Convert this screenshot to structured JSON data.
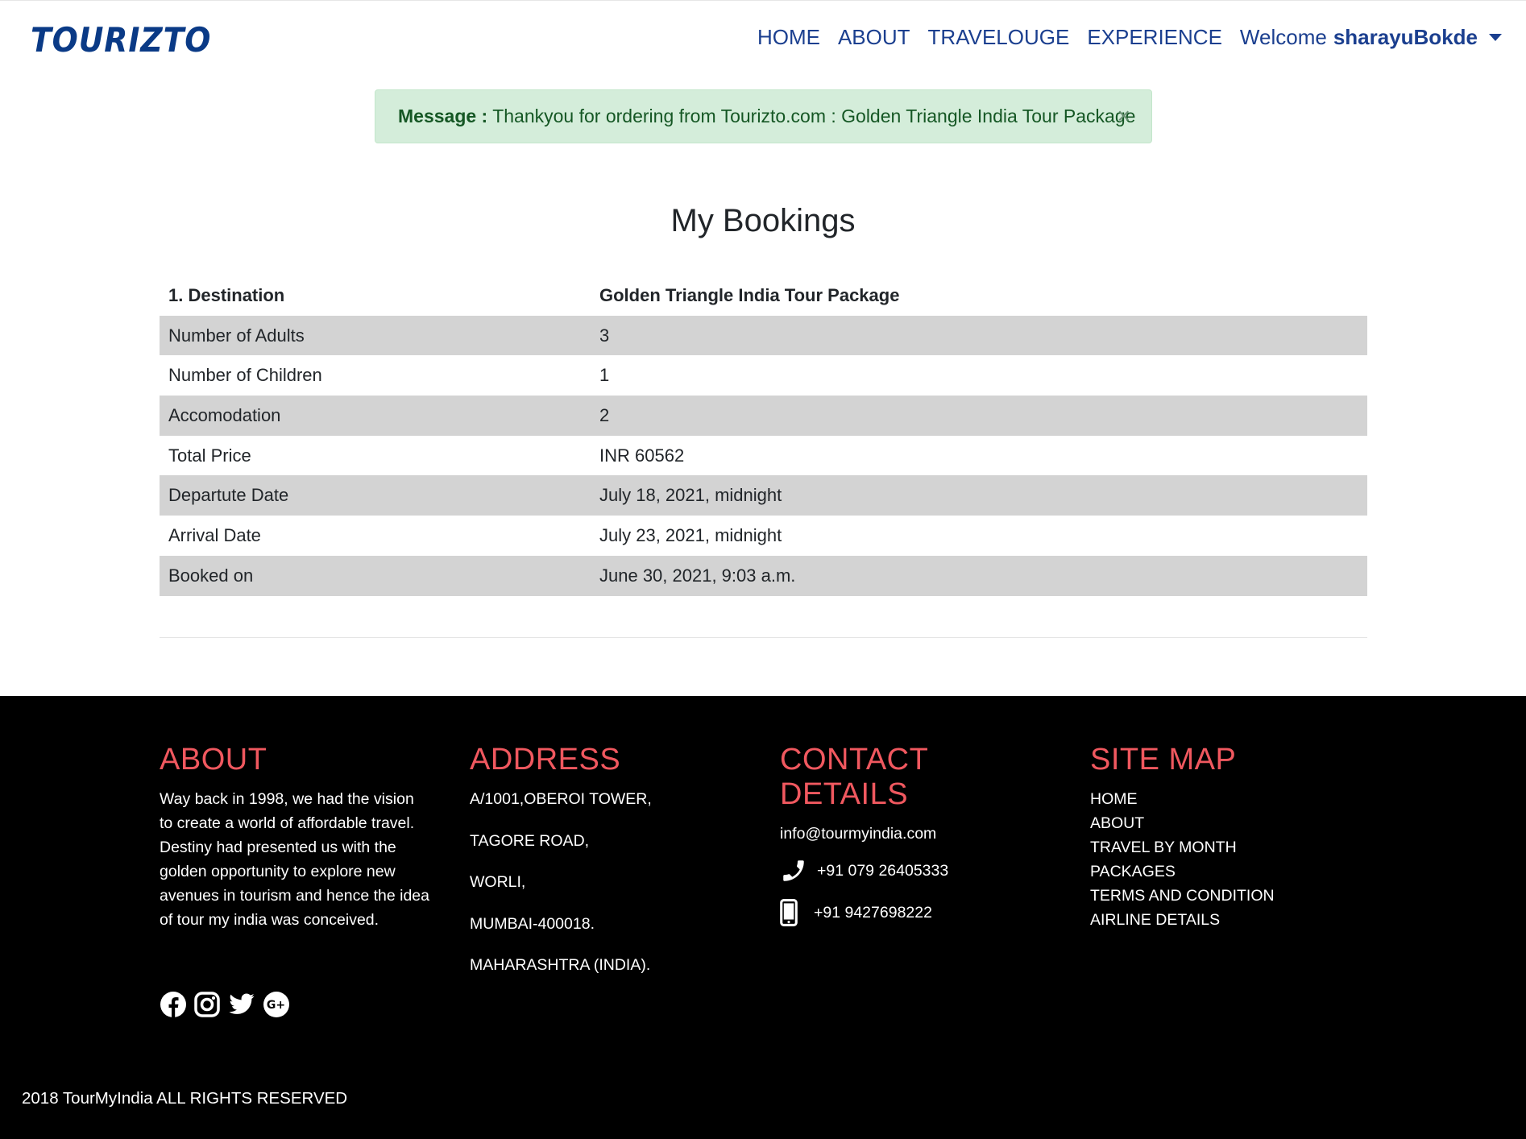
{
  "navbar": {
    "brand": "TOURIZTO",
    "links": [
      {
        "label": "HOME"
      },
      {
        "label": "ABOUT"
      },
      {
        "label": "TRAVELOUGE"
      },
      {
        "label": "EXPERIENCE"
      }
    ],
    "welcome_label": "Welcome",
    "username": "sharayuBokde"
  },
  "alert": {
    "prefix": "Message :",
    "text": "Thankyou for ordering from Tourizto.com : Golden Triangle India Tour Package",
    "close": "×"
  },
  "page_title": "My Bookings",
  "booking": {
    "rows": [
      {
        "label": "1. Destination",
        "value": "Golden Triangle India Tour Package"
      },
      {
        "label": "Number of Adults",
        "value": "3"
      },
      {
        "label": "Number of Children",
        "value": "1"
      },
      {
        "label": "Accomodation",
        "value": "2"
      },
      {
        "label": "Total Price",
        "value": "INR 60562"
      },
      {
        "label": "Departute Date",
        "value": "July 18, 2021, midnight"
      },
      {
        "label": "Arrival Date",
        "value": "July 23, 2021, midnight"
      },
      {
        "label": "Booked on",
        "value": "June 30, 2021, 9:03 a.m."
      }
    ]
  },
  "footer": {
    "about": {
      "title": "ABOUT",
      "lines": [
        "Way back in 1998, we had the vision",
        "to create a world of affordable travel.",
        "Destiny had presented us with the",
        "golden opportunity to explore new",
        "avenues in tourism and hence the idea",
        "of tour my india was conceived."
      ]
    },
    "address": {
      "title": "ADDRESS",
      "lines": [
        "A/1001,OBEROI TOWER,",
        "TAGORE ROAD,",
        "WORLI,",
        "MUMBAI-400018.",
        "MAHARASHTRA (INDIA)."
      ]
    },
    "contact": {
      "title": "CONTACT DETAILS",
      "email": "info@tourmyindia.com",
      "phone": "+91 079 26405333",
      "mobile": "+91 9427698222"
    },
    "sitemap": {
      "title": "SITE MAP",
      "links": [
        "HOME",
        "ABOUT",
        "TRAVEL BY MONTH",
        "PACKAGES",
        "TERMS AND CONDITION",
        "AIRLINE DETAILS"
      ]
    },
    "social_icons": [
      "facebook-icon",
      "instagram-icon",
      "twitter-icon",
      "google-plus-icon"
    ],
    "copyright": "2018 TourMyIndia ALL RIGHTS RESERVED"
  },
  "colors": {
    "brand": "#0a3a86",
    "nav": "#1b3f8f",
    "footer_heading": "#f0585f",
    "alert_bg": "#d4edda",
    "stripe": "#d3d3d3"
  }
}
